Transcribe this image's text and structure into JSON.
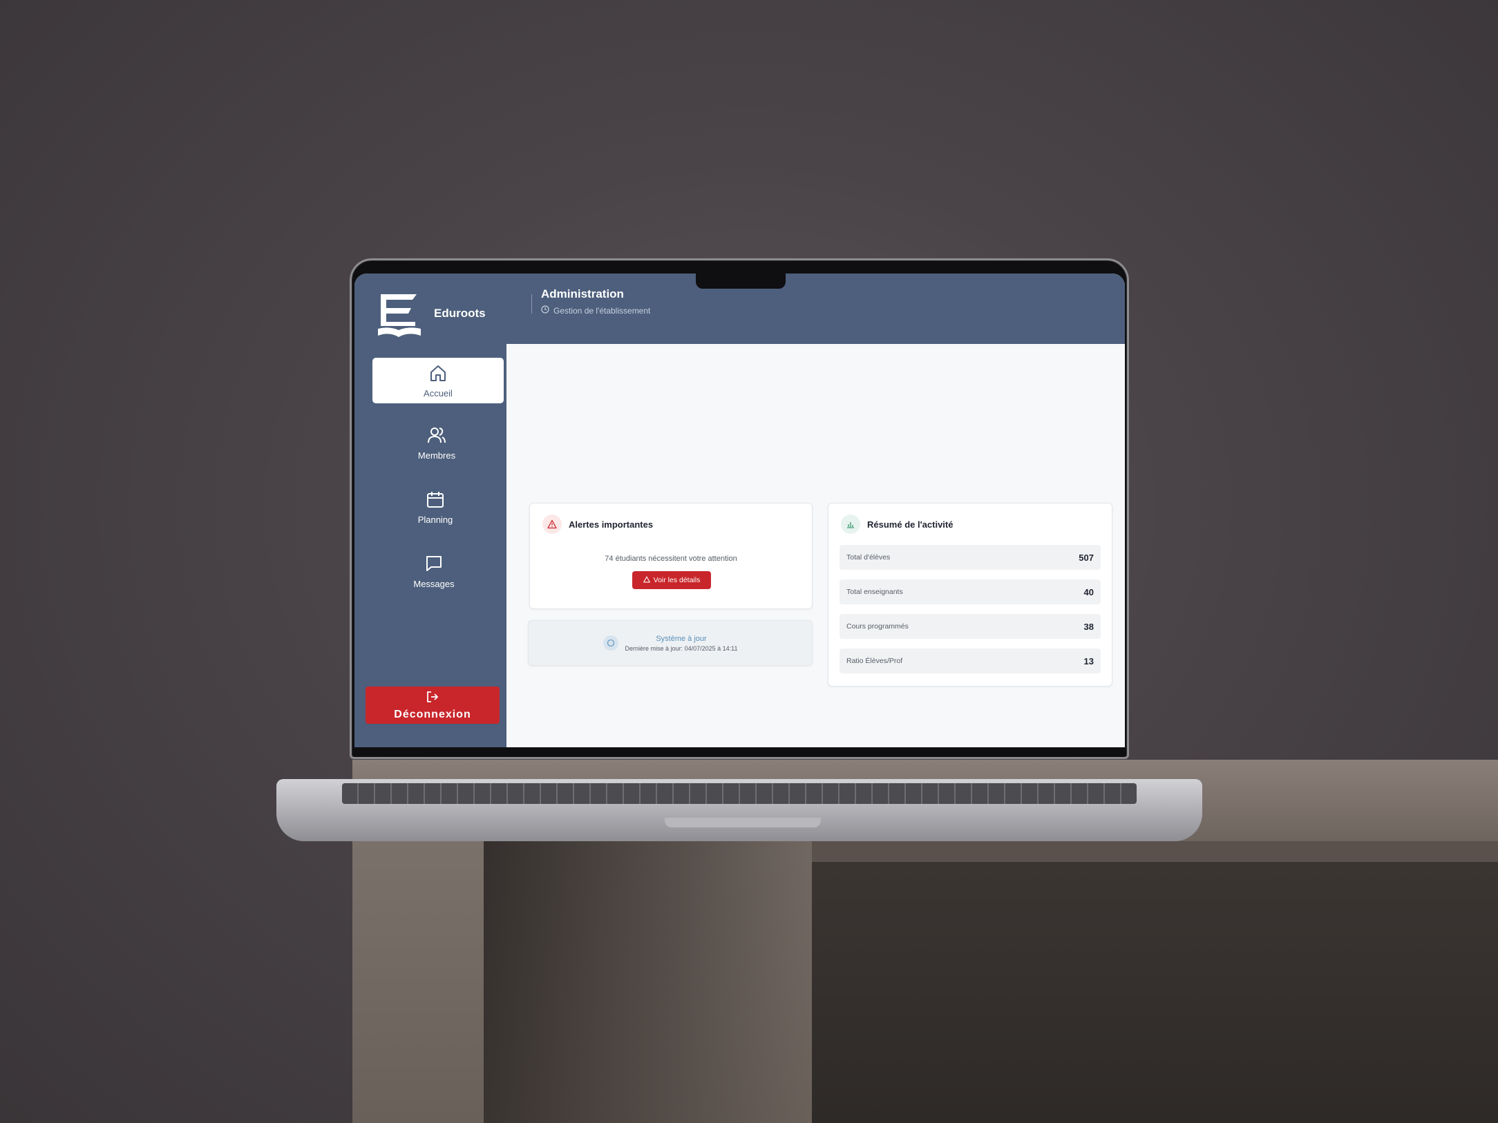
{
  "app": {
    "brand": "Eduroots",
    "title": "Administration",
    "subtitle": "Gestion de l'établissement"
  },
  "sidebar": {
    "items": [
      {
        "label": "Accueil",
        "icon": "home-icon",
        "active": true
      },
      {
        "label": "Membres",
        "icon": "users-icon",
        "active": false
      },
      {
        "label": "Planning",
        "icon": "calendar-icon",
        "active": false
      },
      {
        "label": "Messages",
        "icon": "message-icon",
        "active": false
      }
    ],
    "logout_label": "Déconnexion"
  },
  "alerts": {
    "title": "Alertes importantes",
    "message": "74 étudiants nécessitent votre attention",
    "button_label": "Voir les détails"
  },
  "status": {
    "title": "Système à jour",
    "updated": "Dernière mise à jour: 04/07/2025 à 14:11"
  },
  "activity": {
    "title": "Résumé de l'activité",
    "rows": [
      {
        "label": "Total d'élèves",
        "value": "507"
      },
      {
        "label": "Total enseignants",
        "value": "40"
      },
      {
        "label": "Cours programmés",
        "value": "38"
      },
      {
        "label": "Ratio Élèves/Prof",
        "value": "13"
      }
    ]
  },
  "colors": {
    "sidebar": "#4d5f7c",
    "danger": "#c8262b",
    "background": "#f7f8fa"
  }
}
